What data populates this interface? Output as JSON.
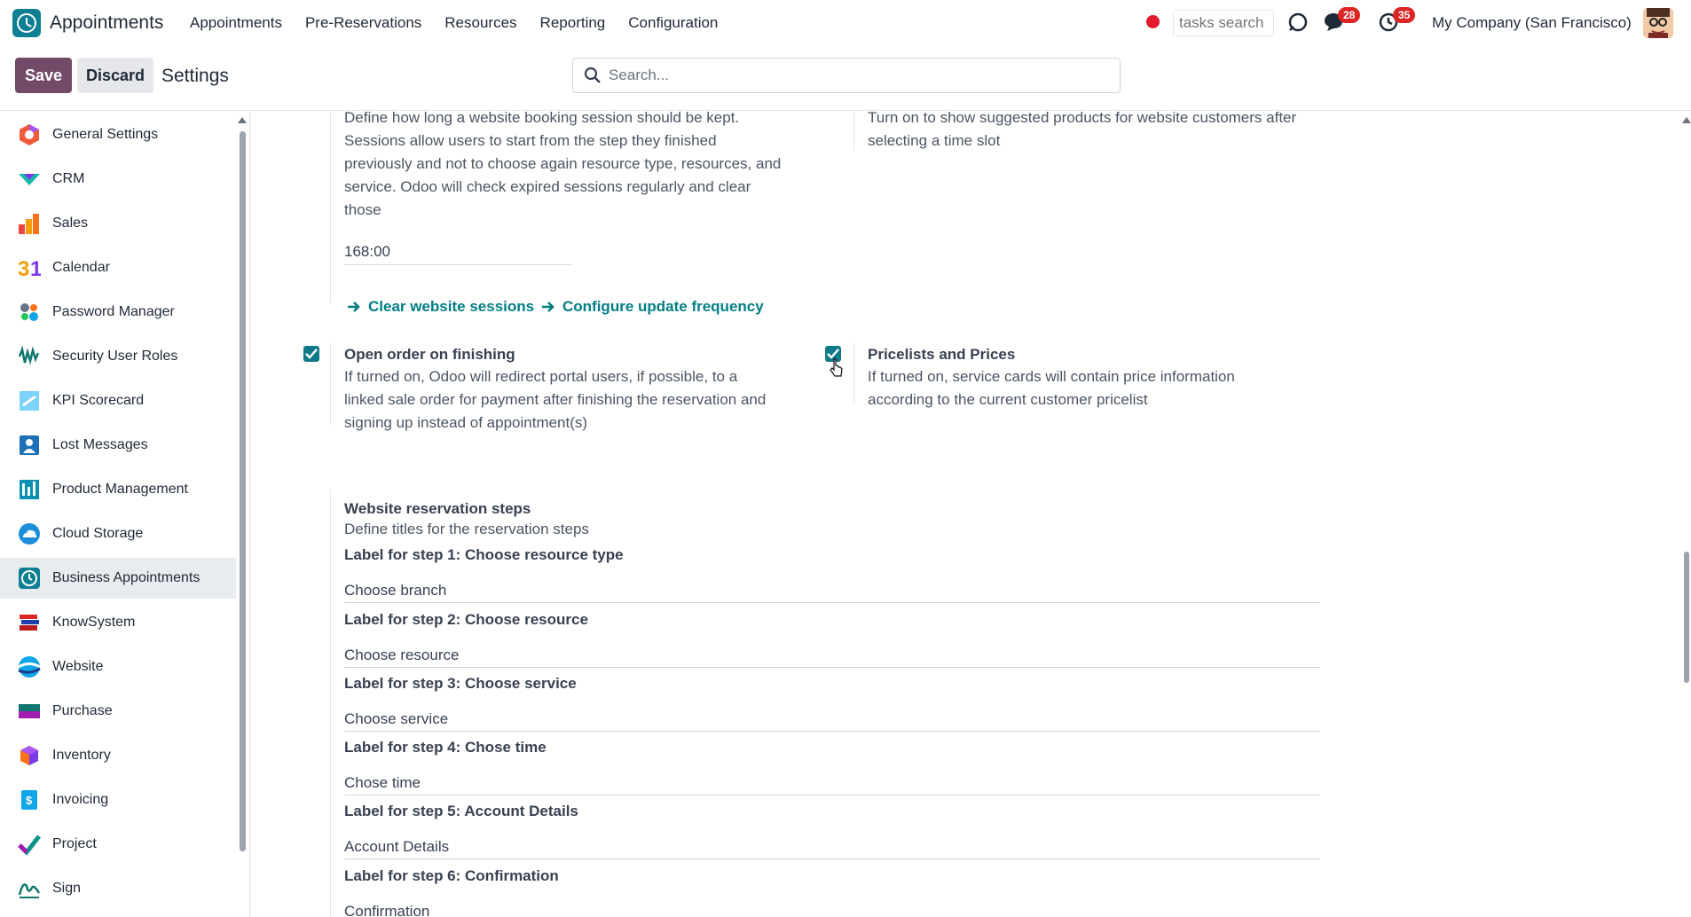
{
  "navbar": {
    "app_name": "Appointments",
    "menu": [
      "Appointments",
      "Pre-Reservations",
      "Resources",
      "Reporting",
      "Configuration"
    ],
    "tasks_search_placeholder": "tasks search",
    "messages_badge": "28",
    "activities_badge": "35",
    "company": "My Company (San Francisco)"
  },
  "control": {
    "save_label": "Save",
    "discard_label": "Discard",
    "title": "Settings",
    "search_placeholder": "Search..."
  },
  "sidebar": {
    "items": [
      {
        "label": "General Settings",
        "icon": "gear-hexagon-icon"
      },
      {
        "label": "CRM",
        "icon": "crm-icon"
      },
      {
        "label": "Sales",
        "icon": "sales-chart-icon"
      },
      {
        "label": "Calendar",
        "icon": "calendar-icon"
      },
      {
        "label": "Password Manager",
        "icon": "password-icon"
      },
      {
        "label": "Security User Roles",
        "icon": "security-roles-icon"
      },
      {
        "label": "KPI Scorecard",
        "icon": "kpi-icon"
      },
      {
        "label": "Lost Messages",
        "icon": "lost-messages-icon"
      },
      {
        "label": "Product Management",
        "icon": "product-management-icon"
      },
      {
        "label": "Cloud Storage",
        "icon": "cloud-icon"
      },
      {
        "label": "Business Appointments",
        "icon": "appointments-clock-icon"
      },
      {
        "label": "KnowSystem",
        "icon": "books-icon"
      },
      {
        "label": "Website",
        "icon": "website-icon"
      },
      {
        "label": "Purchase",
        "icon": "purchase-icon"
      },
      {
        "label": "Inventory",
        "icon": "inventory-box-icon"
      },
      {
        "label": "Invoicing",
        "icon": "invoicing-icon"
      },
      {
        "label": "Project",
        "icon": "project-check-icon"
      },
      {
        "label": "Sign",
        "icon": "sign-icon"
      }
    ],
    "active_index": 10
  },
  "settings": {
    "session": {
      "desc_lines": [
        "Define how long a website booking session should be kept.",
        "Sessions allow users to start from the step they finished",
        "previously and not to choose again resource type, resources, and",
        "service. Odoo will check expired sessions regularly and clear",
        "those"
      ],
      "value": "168:00",
      "link_clear": "Clear website sessions",
      "link_configure": "Configure update frequency"
    },
    "suggested": {
      "desc_lines": [
        "Turn on to show suggested products for website customers after",
        "selecting a time slot"
      ]
    },
    "open_order": {
      "title": "Open order on finishing",
      "checked": true,
      "desc_lines": [
        "If turned on, Odoo will redirect portal users, if possible, to a",
        "linked sale order for payment after finishing the reservation and",
        "signing up instead of appointment(s)"
      ]
    },
    "pricelists": {
      "title": "Pricelists and Prices",
      "checked": true,
      "desc_lines": [
        "If turned on, service cards will contain price information",
        "according to the current customer pricelist"
      ]
    },
    "steps": {
      "title": "Website reservation steps",
      "subtitle": "Define titles for the reservation steps",
      "items": [
        {
          "label": "Label for step 1: Choose resource type",
          "value": "Choose branch"
        },
        {
          "label": "Label for step 2: Choose resource",
          "value": "Choose resource"
        },
        {
          "label": "Label for step 3: Choose service",
          "value": "Choose service"
        },
        {
          "label": "Label for step 4: Chose time",
          "value": "Chose time"
        },
        {
          "label": "Label for step 5: Account Details",
          "value": "Account Details"
        },
        {
          "label": "Label for step 6: Confirmation",
          "value": "Confirmation"
        }
      ]
    }
  }
}
